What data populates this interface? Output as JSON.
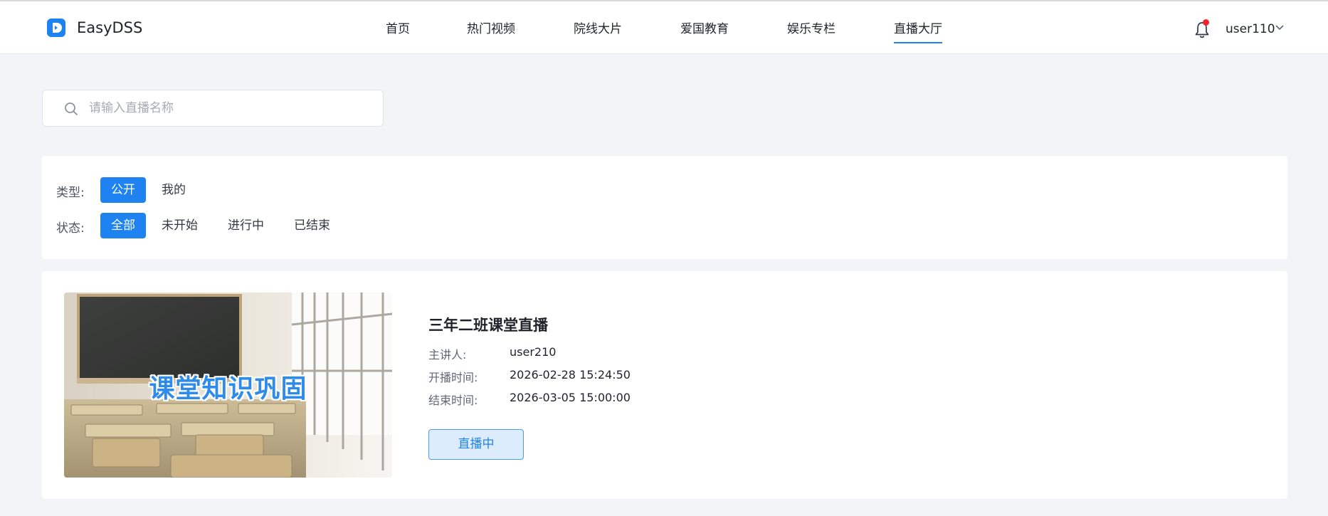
{
  "header": {
    "brand": "EasyDSS",
    "nav": [
      {
        "label": "首页",
        "active": false
      },
      {
        "label": "热门视频",
        "active": false
      },
      {
        "label": "院线大片",
        "active": false
      },
      {
        "label": "爱国教育",
        "active": false
      },
      {
        "label": "娱乐专栏",
        "active": false
      },
      {
        "label": "直播大厅",
        "active": true
      }
    ],
    "username": "user110",
    "icons": {
      "logo": "easydss-logo-icon",
      "bell": "bell-icon",
      "caret": "chevron-down-icon"
    }
  },
  "search": {
    "placeholder": "请输入直播名称",
    "value": "",
    "icon": "search-icon"
  },
  "filters": {
    "type": {
      "label": "类型:",
      "options": [
        "公开",
        "我的"
      ],
      "selected": "公开"
    },
    "status": {
      "label": "状态:",
      "options": [
        "全部",
        "未开始",
        "进行中",
        "已结束"
      ],
      "selected": "全部"
    }
  },
  "live_card": {
    "thumbnail_caption": "课堂知识巩固",
    "title": "三年二班课堂直播",
    "fields": [
      {
        "key": "主讲人:",
        "value": "user210"
      },
      {
        "key": "开播时间:",
        "value": "2026-02-28 15:24:50"
      },
      {
        "key": "结束时间:",
        "value": "2026-03-05 15:00:00"
      }
    ],
    "status_label": "直播中"
  },
  "colors": {
    "accent": "#1e82f0",
    "notification": "#f5222d",
    "background": "#f2f4f7"
  }
}
